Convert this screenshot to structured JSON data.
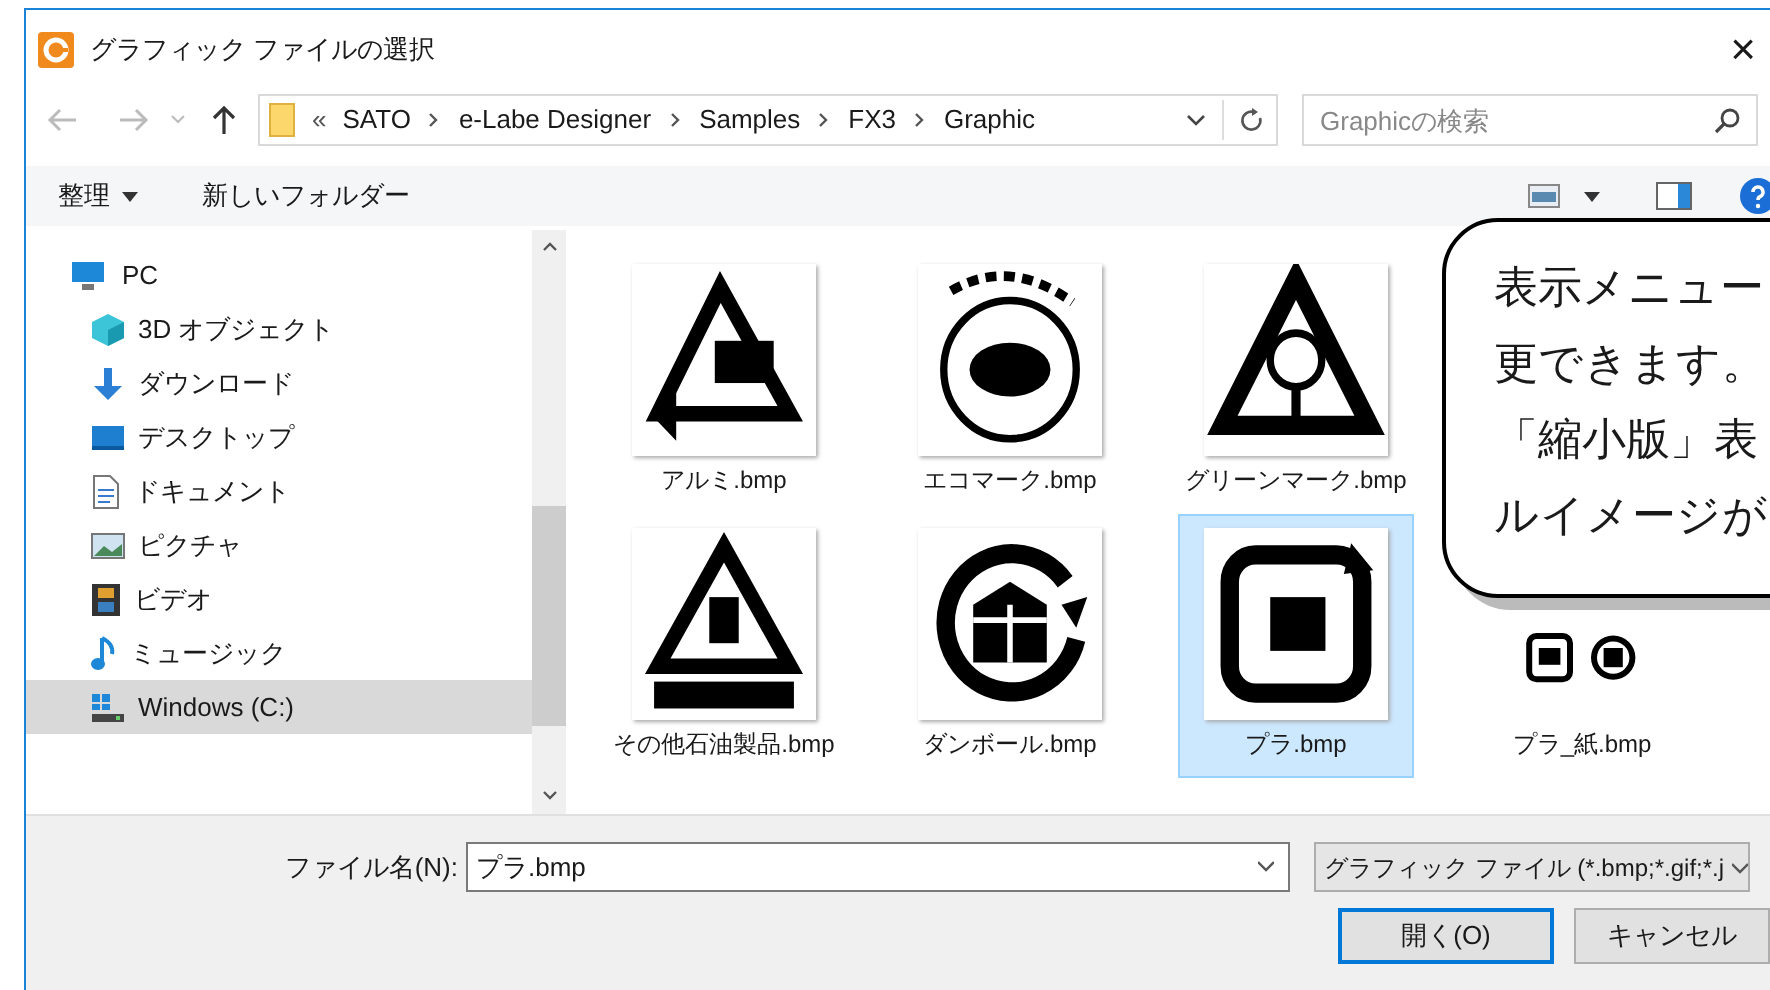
{
  "window": {
    "title": "グラフィック ファイルの選択",
    "close": "×"
  },
  "address": {
    "prefix": "«",
    "crumbs": [
      "SATO",
      "e-Labe Designer",
      "Samples",
      "FX3",
      "Graphic"
    ]
  },
  "search": {
    "placeholder": "Graphicの検索"
  },
  "toolbar": {
    "organize": "整理",
    "new_folder": "新しいフォルダー"
  },
  "sidebar": {
    "items": [
      {
        "label": "PC",
        "selected": false,
        "children": [
          {
            "label": "3D オブジェクト",
            "selected": false
          },
          {
            "label": "ダウンロード",
            "selected": false
          },
          {
            "label": "デスクトップ",
            "selected": false
          },
          {
            "label": "ドキュメント",
            "selected": false
          },
          {
            "label": "ピクチャ",
            "selected": false
          },
          {
            "label": "ビデオ",
            "selected": false
          },
          {
            "label": "ミュージック",
            "selected": false
          },
          {
            "label": "Windows (C:)",
            "selected": true
          }
        ]
      }
    ]
  },
  "files": [
    {
      "name": "アルミ.bmp",
      "selected": false
    },
    {
      "name": "エコマーク.bmp",
      "selected": false
    },
    {
      "name": "グリーンマーク.bmp",
      "selected": false
    },
    {
      "name": "その他石油製品.bmp",
      "selected": false
    },
    {
      "name": "ダンボール.bmp",
      "selected": false
    },
    {
      "name": "プラ.bmp",
      "selected": true
    },
    {
      "name": "プラ_紙.bmp",
      "selected": false
    }
  ],
  "callout": {
    "lines": [
      "表示メニュー",
      "更できます。",
      "「縮小版」表",
      "ルイメージが"
    ]
  },
  "footer": {
    "filename_label": "ファイル名(N):",
    "filename": "プラ.bmp",
    "filter": "グラフィック ファイル (*.bmp;*.gif;*.j",
    "open": "開く(O)",
    "cancel": "キャンセル"
  }
}
